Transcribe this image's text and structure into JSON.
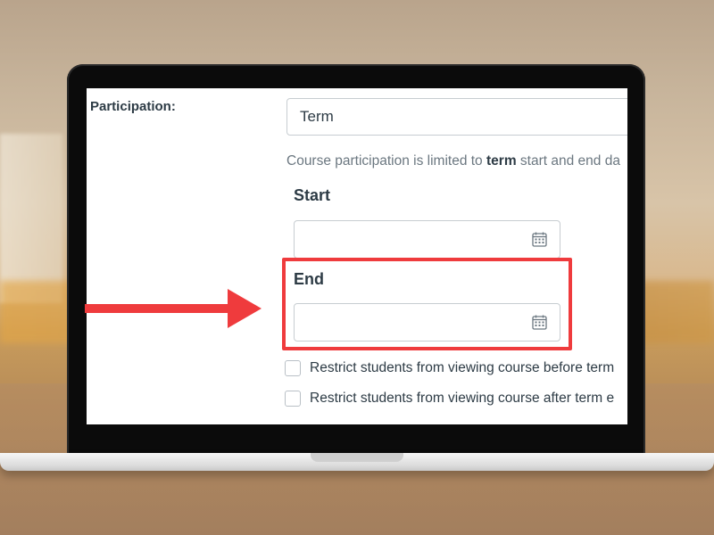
{
  "participation": {
    "label": "Participation:",
    "select_value": "Term",
    "help_prefix": "Course participation is limited to ",
    "help_bold": "term",
    "help_suffix": " start and end da"
  },
  "start": {
    "label": "Start",
    "value": ""
  },
  "end": {
    "label": "End",
    "value": ""
  },
  "restrictions": [
    {
      "label": "Restrict students from viewing course before term",
      "checked": false
    },
    {
      "label": "Restrict students from viewing course after term e",
      "checked": false
    }
  ],
  "colors": {
    "highlight": "#ef3b3d",
    "text": "#2d3b45",
    "muted": "#6b7780",
    "border": "#c7cdd1"
  },
  "icons": {
    "select_toggle": "chevron-down-icon",
    "date_picker": "calendar-icon",
    "annotation": "right-arrow"
  }
}
